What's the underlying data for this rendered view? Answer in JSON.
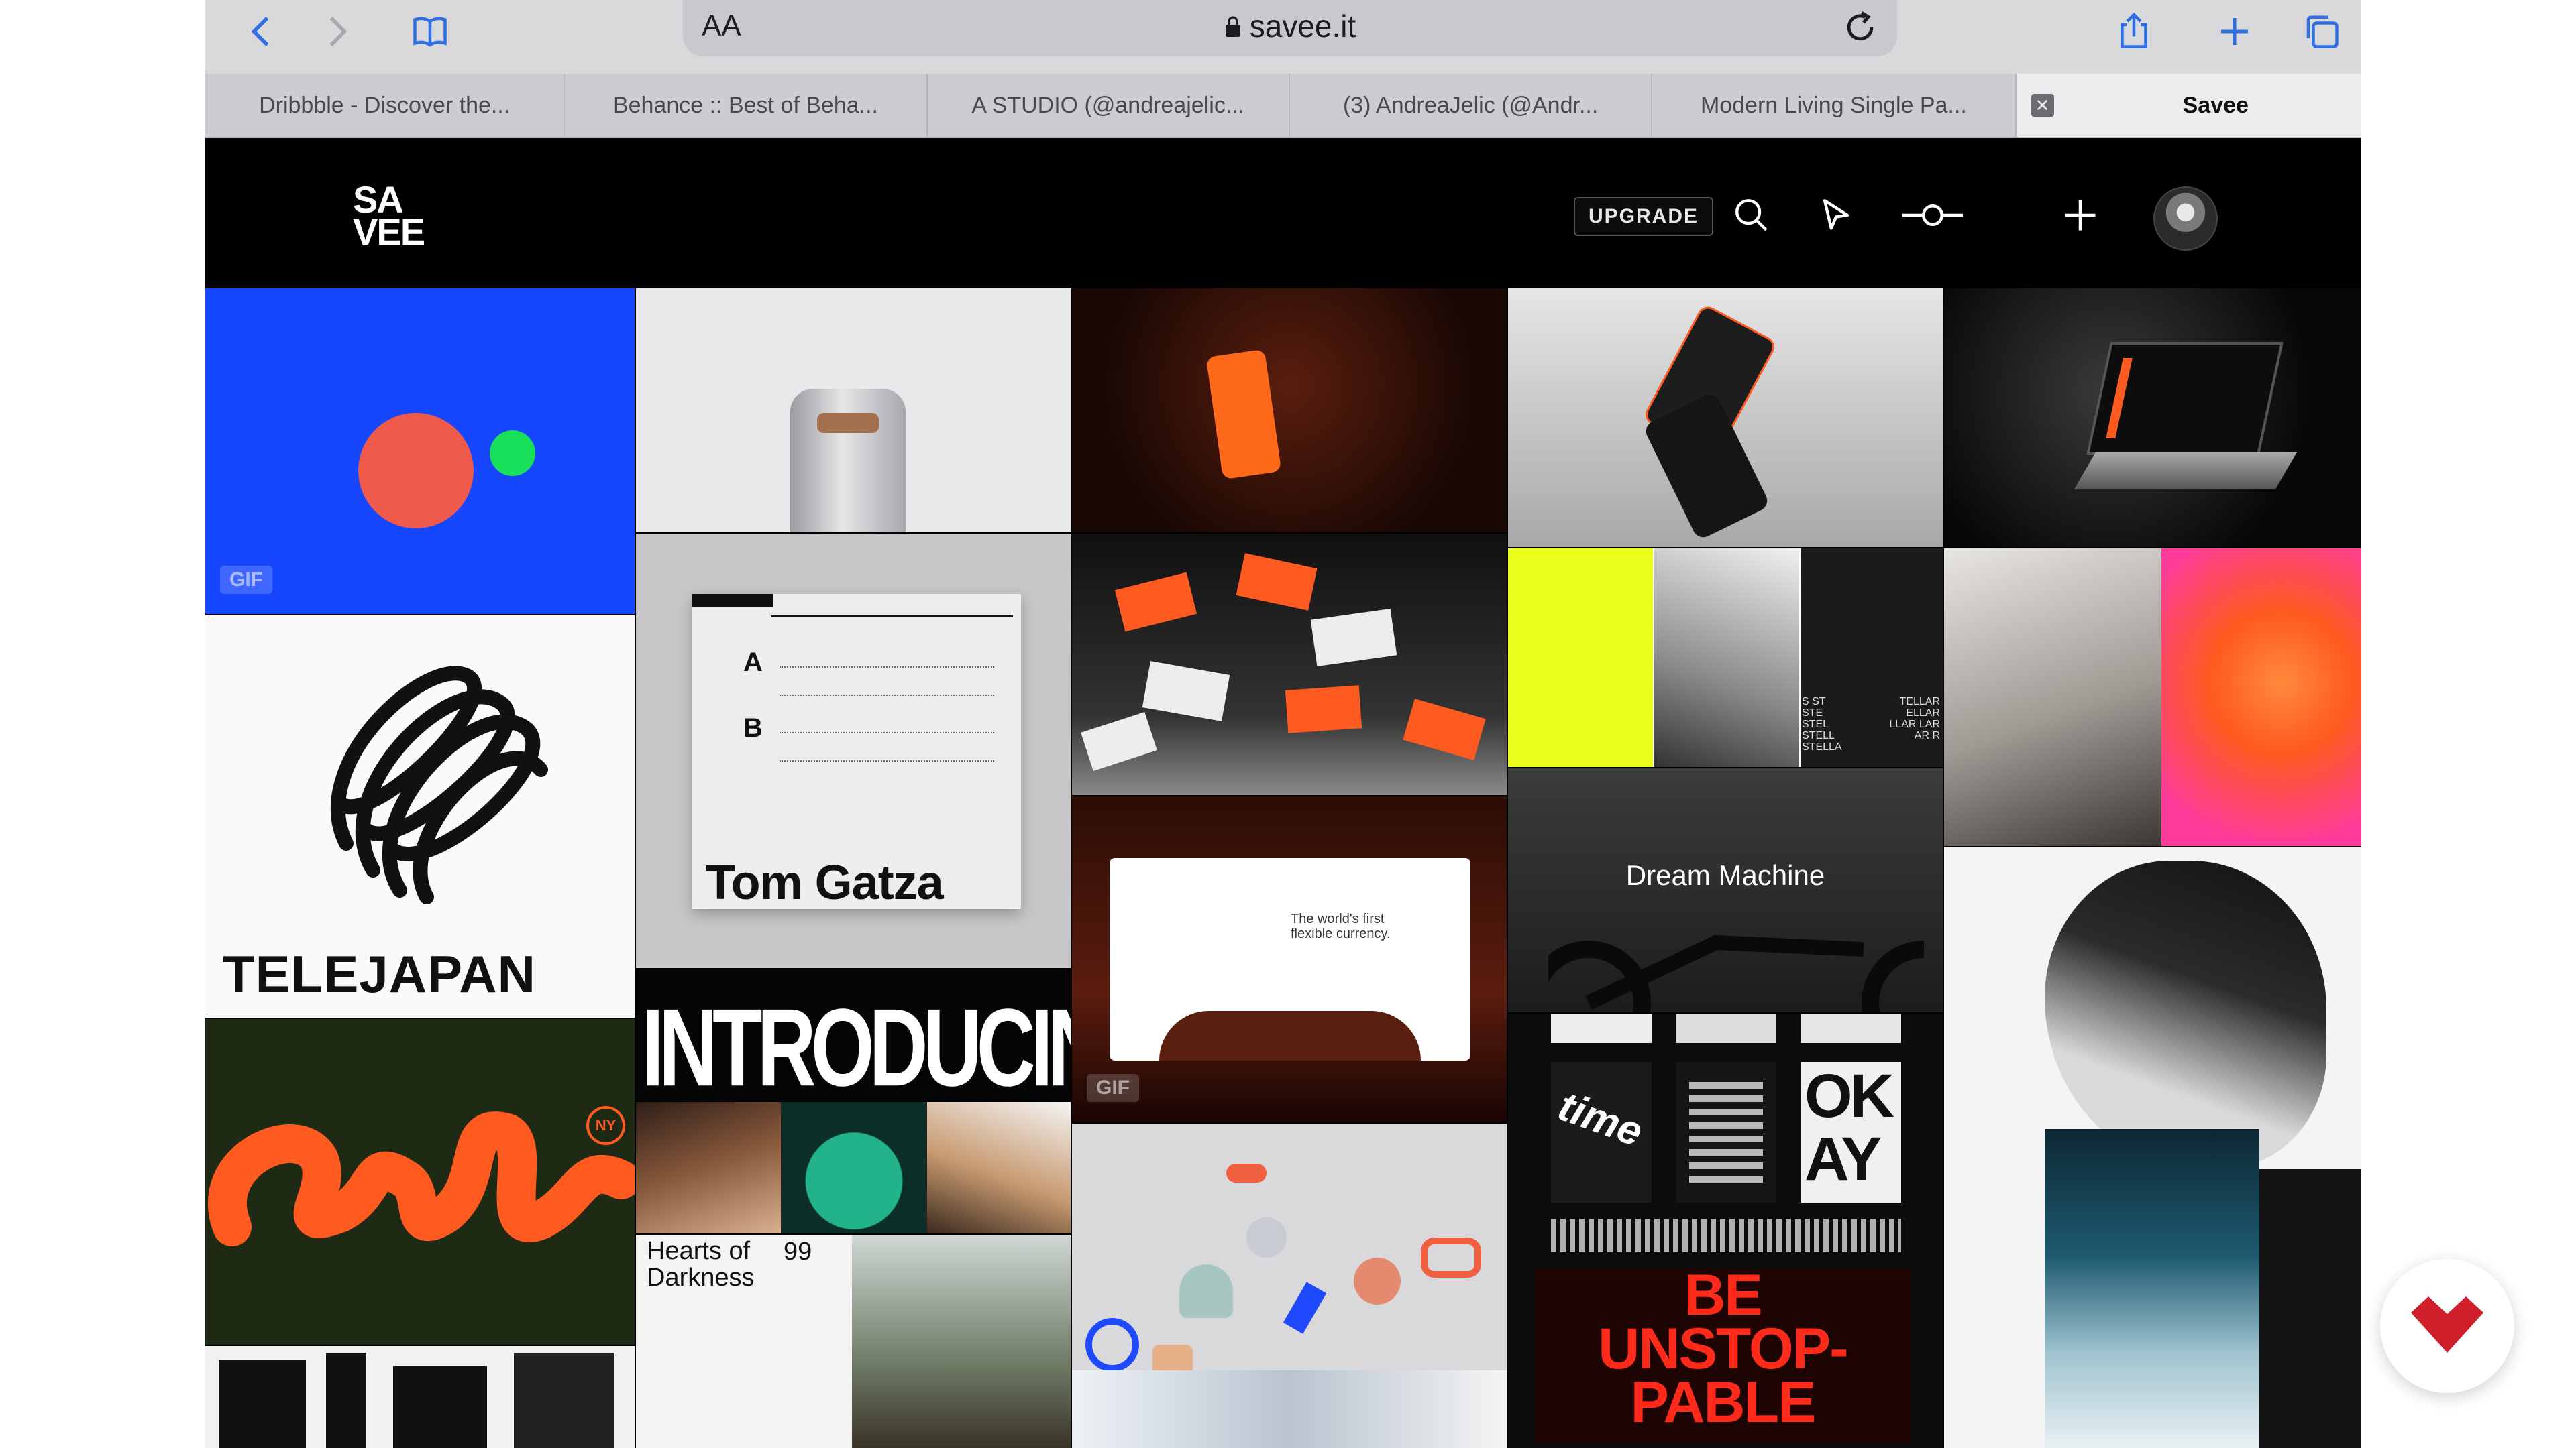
{
  "browser": {
    "address": {
      "text_size": "AA",
      "url": "savee.it"
    },
    "icons": [
      "back-icon",
      "forward-icon",
      "bookmarks-icon",
      "share-icon",
      "new-tab-icon",
      "tabs-overview-icon",
      "lock-icon",
      "reload-icon"
    ],
    "tabs": [
      {
        "label": "Dribbble - Discover the..."
      },
      {
        "label": "Behance :: Best of Beha..."
      },
      {
        "label": "A STUDIO (@andreajelic..."
      },
      {
        "label": "(3) AndreaJelic (@Andr..."
      },
      {
        "label": "Modern Living Single Pa..."
      },
      {
        "label": "Savee",
        "active": true,
        "close": "✕"
      }
    ]
  },
  "app": {
    "logo_line1": "SA",
    "logo_line2": "VEE",
    "upgrade_label": "UPGRADE",
    "colors": {
      "header_bg": "#000000",
      "tile_blue": "#1746ff",
      "neon_yellow": "#eaff1c",
      "accent_orange": "#ff5a1f",
      "brand_red": "#cf1f2a"
    }
  },
  "tiles": {
    "gif_badge": "GIF",
    "telejapan": "TELEJAPAN",
    "tom_gatza": "Tom Gatza",
    "record_a": "A",
    "record_b": "B",
    "introducing": "INTRODUCING",
    "hearts_title": "Hearts of Darkness",
    "hearts_number": "99",
    "dream_machine": "Dream Machine",
    "worlds_first": "The world's first flexible currency.",
    "be_unstoppable": "BE UNSTOP- PABLE",
    "telle_list": "TELLAR ELLAR LLAR LAR AR R",
    "stella_list": "S ST STE STEL STELL STELLA",
    "time_word": "time",
    "okay_word": "OK AY",
    "ny_badge": "NY"
  }
}
